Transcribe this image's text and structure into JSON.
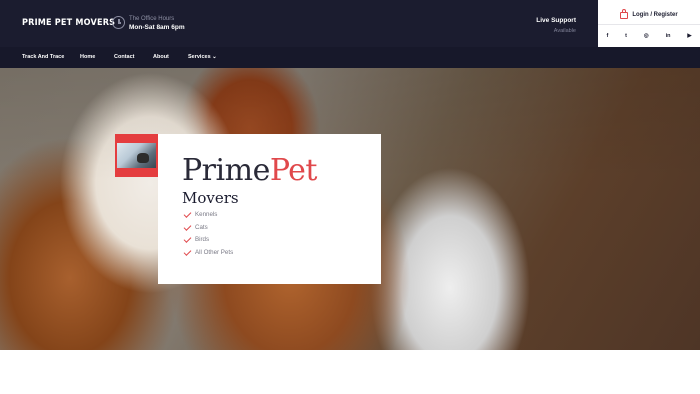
{
  "header": {
    "brand": "PRIME PET MOVERS",
    "office_hours_label": "The Office Hours",
    "office_hours_value": "Mon-Sat 8am 6pm",
    "support_title": "Live Support",
    "support_status": "Available"
  },
  "account": {
    "login_label": "Login / Register",
    "socials": [
      {
        "icon": "facebook-icon",
        "glyph": "f"
      },
      {
        "icon": "twitter-icon",
        "glyph": "t"
      },
      {
        "icon": "instagram-icon",
        "glyph": "◎"
      },
      {
        "icon": "linkedin-icon",
        "glyph": "in"
      },
      {
        "icon": "youtube-icon",
        "glyph": "▶"
      }
    ]
  },
  "nav": {
    "items": [
      "Track And Trace",
      "Home",
      "Contact",
      "About",
      "Services ⌄"
    ]
  },
  "hero": {
    "title_part1": "Prime",
    "title_part2": "Pet",
    "subtitle": "Movers",
    "features": [
      "Kennels",
      "Cats",
      "Birds",
      "All Other Pets"
    ]
  },
  "colors": {
    "accent": "#e0484b",
    "dark": "#1b1c2f"
  }
}
